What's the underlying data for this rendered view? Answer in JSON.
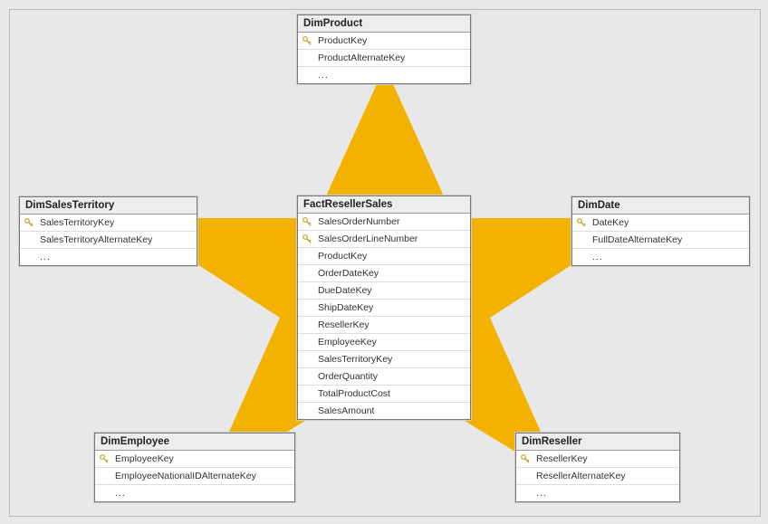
{
  "diagram": {
    "tables": {
      "DimProduct": {
        "title": "DimProduct",
        "columns": [
          {
            "name": "ProductKey",
            "pk": true
          },
          {
            "name": "ProductAlternateKey",
            "pk": false
          }
        ],
        "ellipsis": "..."
      },
      "DimSalesTerritory": {
        "title": "DimSalesTerritory",
        "columns": [
          {
            "name": "SalesTerritoryKey",
            "pk": true
          },
          {
            "name": "SalesTerritoryAlternateKey",
            "pk": false
          }
        ],
        "ellipsis": "..."
      },
      "FactResellerSales": {
        "title": "FactResellerSales",
        "columns": [
          {
            "name": "SalesOrderNumber",
            "pk": true
          },
          {
            "name": "SalesOrderLineNumber",
            "pk": true
          },
          {
            "name": "ProductKey",
            "pk": false
          },
          {
            "name": "OrderDateKey",
            "pk": false
          },
          {
            "name": "DueDateKey",
            "pk": false
          },
          {
            "name": "ShipDateKey",
            "pk": false
          },
          {
            "name": "ResellerKey",
            "pk": false
          },
          {
            "name": "EmployeeKey",
            "pk": false
          },
          {
            "name": "SalesTerritoryKey",
            "pk": false
          },
          {
            "name": "OrderQuantity",
            "pk": false
          },
          {
            "name": "TotalProductCost",
            "pk": false
          },
          {
            "name": "SalesAmount",
            "pk": false
          }
        ],
        "ellipsis": null
      },
      "DimDate": {
        "title": "DimDate",
        "columns": [
          {
            "name": "DateKey",
            "pk": true
          },
          {
            "name": "FullDateAlternateKey",
            "pk": false
          }
        ],
        "ellipsis": "..."
      },
      "DimEmployee": {
        "title": "DimEmployee",
        "columns": [
          {
            "name": "EmployeeKey",
            "pk": true
          },
          {
            "name": "EmployeeNationalIDAlternateKey",
            "pk": false
          }
        ],
        "ellipsis": "..."
      },
      "DimReseller": {
        "title": "DimReseller",
        "columns": [
          {
            "name": "ResellerKey",
            "pk": true
          },
          {
            "name": "ResellerAlternateKey",
            "pk": false
          }
        ],
        "ellipsis": "..."
      }
    },
    "star_color": "#f3b200",
    "key_icon_color": "#d9be42"
  }
}
